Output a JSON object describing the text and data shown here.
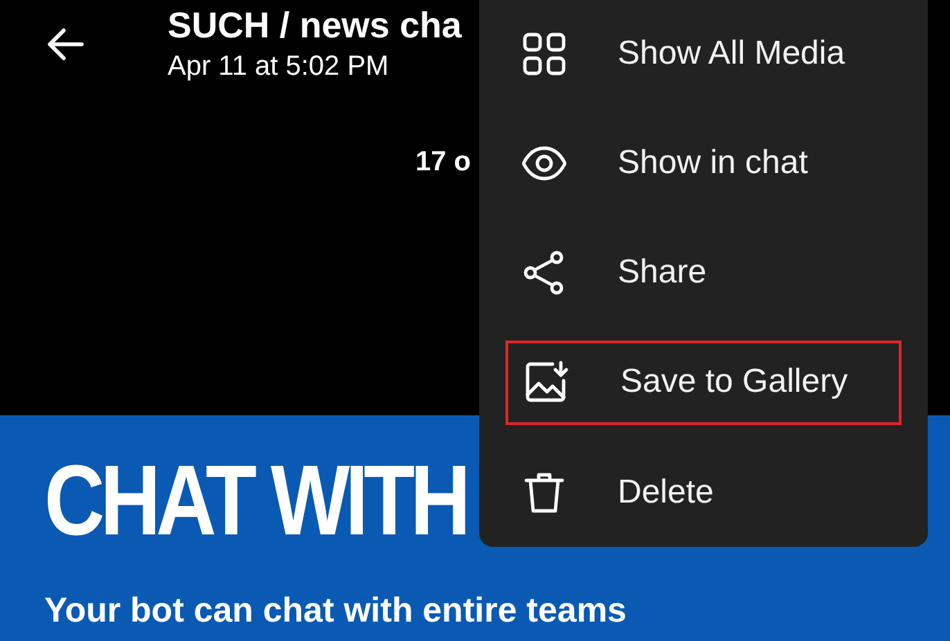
{
  "header": {
    "title": "SUCH / news cha",
    "subtitle": "Apr 11 at 5:02 PM",
    "counter": "17 o"
  },
  "banner": {
    "headline": "CHAT WITH",
    "tagline": "Your bot can chat with entire teams"
  },
  "menu": {
    "items": [
      {
        "kind": "grid",
        "label": "Show All Media",
        "highlighted": false
      },
      {
        "kind": "eye",
        "label": "Show in chat",
        "highlighted": false
      },
      {
        "kind": "share",
        "label": "Share",
        "highlighted": false
      },
      {
        "kind": "gallery",
        "label": "Save to Gallery",
        "highlighted": true
      },
      {
        "kind": "trash",
        "label": "Delete",
        "highlighted": false
      }
    ]
  }
}
